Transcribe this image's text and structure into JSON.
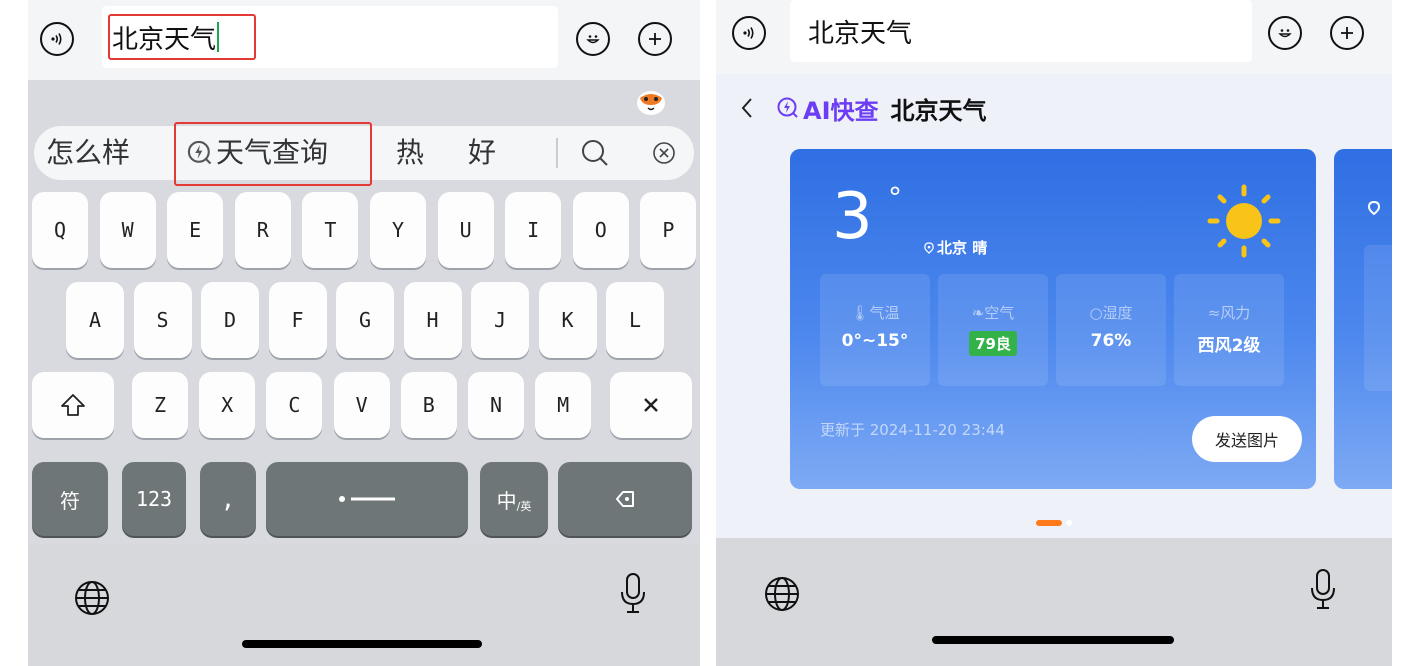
{
  "left": {
    "search_text": "北京天气",
    "candidates": [
      "怎么样",
      "天气查询",
      "热",
      "好"
    ],
    "rows": [
      [
        "Q",
        "W",
        "E",
        "R",
        "T",
        "Y",
        "U",
        "I",
        "O",
        "P"
      ],
      [
        "A",
        "S",
        "D",
        "F",
        "G",
        "H",
        "J",
        "K",
        "L"
      ],
      [
        "Z",
        "X",
        "C",
        "V",
        "B",
        "N",
        "M"
      ]
    ],
    "keys": {
      "symbol": "符",
      "numbers": "123",
      "comma": ",",
      "lang_main": "中",
      "lang_sub": "/英"
    }
  },
  "right": {
    "search_text": "北京天气",
    "ai_label": "AI快查",
    "page_title": "北京天气",
    "weather": {
      "temp": "3",
      "degree": "°",
      "location": "北京 晴",
      "stats": [
        {
          "label": "气温",
          "value": "0°~15°"
        },
        {
          "label": "空气",
          "value": "79良"
        },
        {
          "label": "湿度",
          "value": "76%"
        },
        {
          "label": "风力",
          "value": "西风2级"
        }
      ],
      "updated": "更新于 2024-11-20 23:44",
      "send_label": "发送图片"
    }
  },
  "colors": {
    "accent_purple": "#6d3df5",
    "highlight_red": "#e53935",
    "card_blue": "#2f6fe3",
    "air_good": "#34b24a",
    "sun": "#f7c417"
  }
}
